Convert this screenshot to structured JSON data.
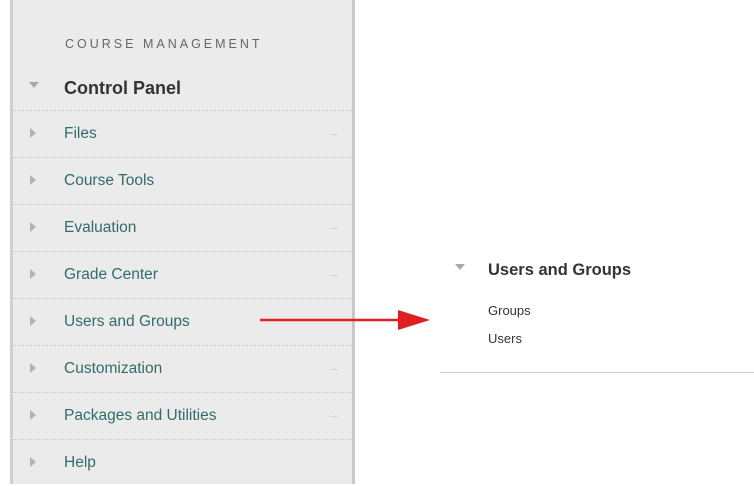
{
  "control_panel": {
    "section_heading": "COURSE MANAGEMENT",
    "title": "Control Panel",
    "items": [
      {
        "label": "Files",
        "arrow": "→"
      },
      {
        "label": "Course Tools",
        "arrow": ""
      },
      {
        "label": "Evaluation",
        "arrow": "→"
      },
      {
        "label": "Grade Center",
        "arrow": "→"
      },
      {
        "label": "Users and Groups",
        "arrow": ""
      },
      {
        "label": "Customization",
        "arrow": "→"
      },
      {
        "label": "Packages and Utilities",
        "arrow": "→"
      },
      {
        "label": "Help",
        "arrow": ""
      }
    ]
  },
  "submenu": {
    "title": "Users and Groups",
    "links": [
      {
        "label": "Groups"
      },
      {
        "label": "Users"
      }
    ]
  },
  "colors": {
    "panel_bg": "#ebebeb",
    "link": "#336b6b",
    "callout_arrow": "#e02020"
  }
}
